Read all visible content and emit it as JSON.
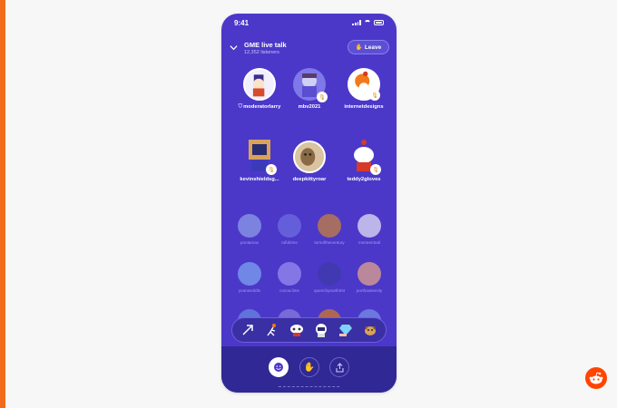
{
  "status_bar": {
    "time": "9:41"
  },
  "header": {
    "title": "GME live talk",
    "listeners": "12,352 listeners",
    "leave_label": "Leave",
    "collapse_icon": "chevron-down-icon",
    "leave_icon": "wave-hand-icon"
  },
  "speakers": [
    {
      "name": "moderatorlarry",
      "moderator": true,
      "color": "#f2f0ff",
      "accent": "#3a2f8a"
    },
    {
      "name": "mbv2021",
      "color": "#cfd0f5",
      "accent": "#5a4fd0"
    },
    {
      "name": "internetdesigns",
      "color": "#ffffff",
      "accent": "#f27a1a"
    },
    {
      "name": "kevinshieldsg...",
      "color": "#d9a25a",
      "accent": "#2b2b70"
    },
    {
      "name": "deepkittyroar",
      "color": "#d9c3a0",
      "accent": "#6b4b2a"
    },
    {
      "name": "teddy2gloves",
      "color": "#ffffff",
      "accent": "#d63a2a"
    }
  ],
  "listeners_grid": [
    {
      "name": "pontamax",
      "color": "#8fa0e8"
    },
    {
      "name": "rufidrime",
      "color": "#6f6ee0"
    },
    {
      "name": "turnofthecentury",
      "color": "#c9823a"
    },
    {
      "name": "moneentrail",
      "color": "#e6e6f7"
    },
    {
      "name": "yoonworldtv",
      "color": "#7fa6f0"
    },
    {
      "name": "cocoa.lime",
      "color": "#9c8ff0"
    },
    {
      "name": "quenchyourthirst",
      "color": "#3d3aa8"
    },
    {
      "name": "porthawsenity",
      "color": "#e7a88a"
    }
  ],
  "reactions": [
    "arrow-up-icon",
    "runner-icon",
    "robot-icon",
    "astronaut-icon",
    "diamond-hands-icon",
    "dog-icon"
  ],
  "bottom_bar": {
    "emoji_button": "smiley-icon",
    "raise_hand_button": "hand-icon",
    "share_button": "share-icon"
  },
  "colors": {
    "brand": "#ff4500",
    "room_bg": "#4b38c9",
    "bottom_bg": "#2f2895",
    "accent_bar": "#f26b1d"
  }
}
